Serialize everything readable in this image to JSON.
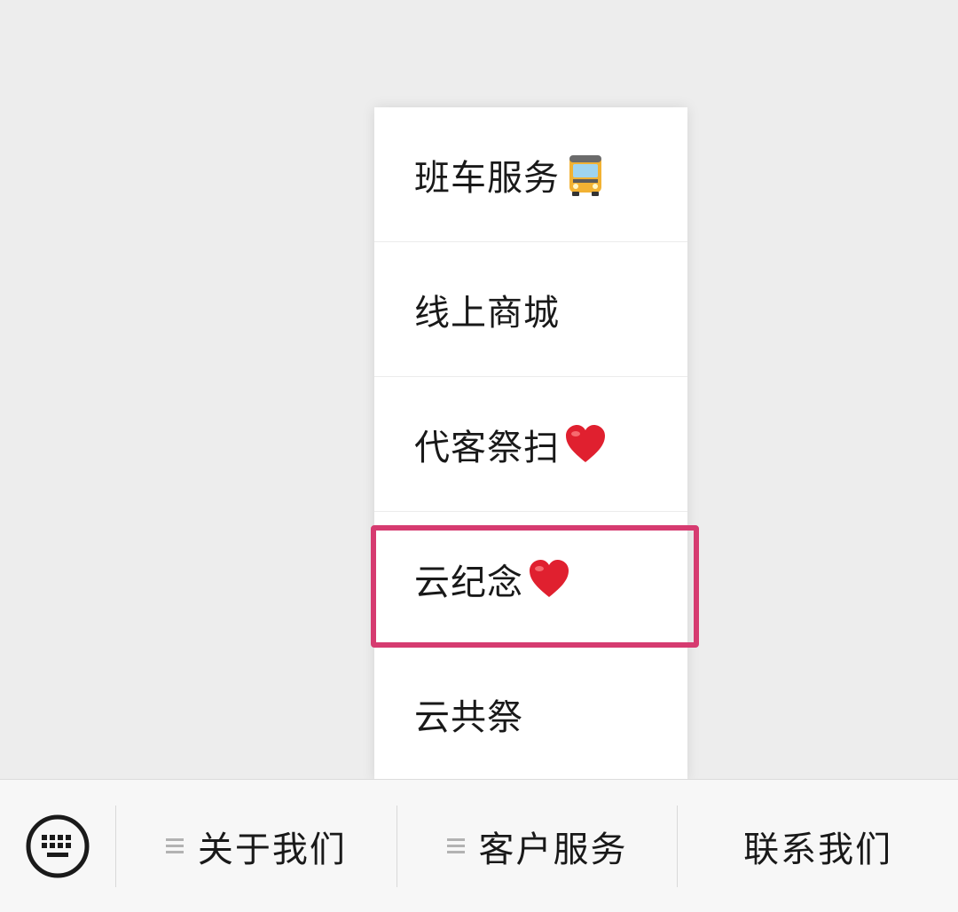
{
  "menu": {
    "items": [
      {
        "label": "班车服务",
        "emoji": "bus-icon"
      },
      {
        "label": "线上商城",
        "emoji": ""
      },
      {
        "label": "代客祭扫",
        "emoji": "heart-icon"
      },
      {
        "label": "云纪念",
        "emoji": "heart-icon"
      },
      {
        "label": "云共祭",
        "emoji": ""
      }
    ]
  },
  "bottom_bar": {
    "keyboard_icon": "keyboard-icon",
    "tabs": [
      {
        "label": "关于我们",
        "has_submenu": true
      },
      {
        "label": "客户服务",
        "has_submenu": true
      },
      {
        "label": "联系我们",
        "has_submenu": false
      }
    ]
  },
  "colors": {
    "page_background": "#ededed",
    "highlight": "#d63b70",
    "heart": "#e0202f"
  }
}
